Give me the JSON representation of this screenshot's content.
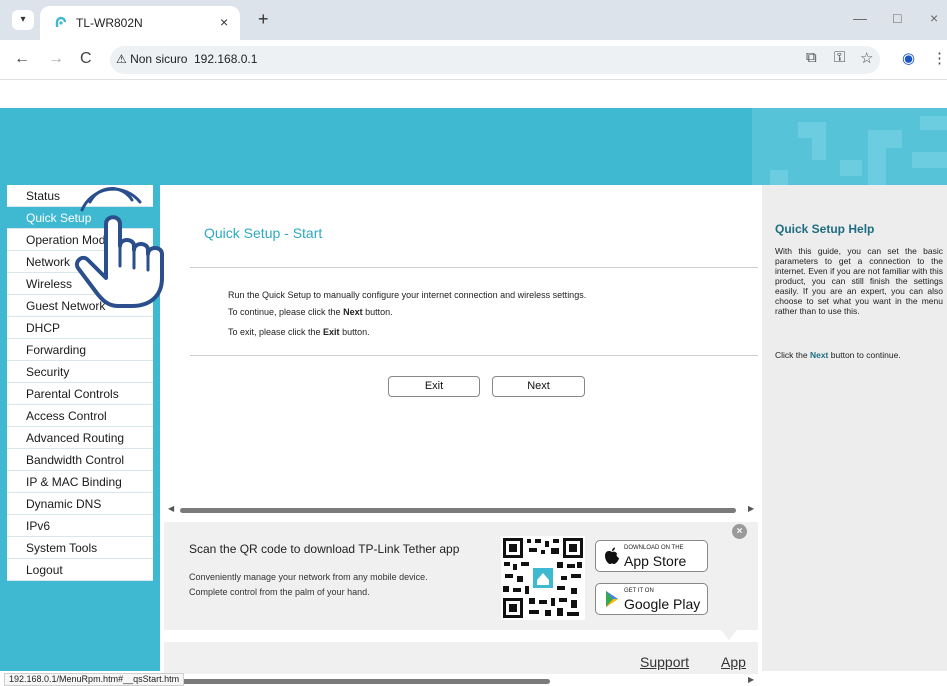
{
  "browser": {
    "tab_title": "TL-WR802N",
    "tab_close": "×",
    "new_tab": "+",
    "back": "←",
    "forward": "→",
    "reload": "C",
    "security_label": "⚠ Non sicuro",
    "url": "192.168.0.1",
    "window_minimize": "—",
    "window_maximize": "□",
    "window_close": "×",
    "status_url": "192.168.0.1/MenuRpm.htm#__qsStart.htm"
  },
  "sidebar": {
    "items": [
      {
        "label": "Status",
        "active": false
      },
      {
        "label": "Quick Setup",
        "active": true
      },
      {
        "label": "Operation Mode",
        "active": false
      },
      {
        "label": "Network",
        "active": false
      },
      {
        "label": "Wireless",
        "active": false
      },
      {
        "label": "Guest Network",
        "active": false
      },
      {
        "label": "DHCP",
        "active": false
      },
      {
        "label": "Forwarding",
        "active": false
      },
      {
        "label": "Security",
        "active": false
      },
      {
        "label": "Parental Controls",
        "active": false
      },
      {
        "label": "Access Control",
        "active": false
      },
      {
        "label": "Advanced Routing",
        "active": false
      },
      {
        "label": "Bandwidth Control",
        "active": false
      },
      {
        "label": "IP & MAC Binding",
        "active": false
      },
      {
        "label": "Dynamic DNS",
        "active": false
      },
      {
        "label": "IPv6",
        "active": false
      },
      {
        "label": "System Tools",
        "active": false
      },
      {
        "label": "Logout",
        "active": false
      }
    ]
  },
  "main": {
    "title": "Quick Setup - Start",
    "line1": "Run the Quick Setup to manually configure your internet connection and wireless settings.",
    "line2_prefix": "To continue, please click the ",
    "line2_bold": "Next",
    "line2_suffix": " button.",
    "line3_prefix": "To exit, please click the ",
    "line3_bold": "Exit",
    "line3_suffix": " button.",
    "exit_label": "Exit",
    "next_label": "Next"
  },
  "promo": {
    "title": "Scan the QR code to download TP-Link Tether app",
    "sub1": "Conveniently manage your network from any mobile device.",
    "sub2": "Complete control from the palm of your hand.",
    "appstore_small": "DOWNLOAD ON THE",
    "appstore_big": "App Store",
    "googleplay_small": "GET IT ON",
    "googleplay_big": "Google Play",
    "close": "×"
  },
  "footer": {
    "support": "Support",
    "app": "App"
  },
  "help": {
    "title": "Quick Setup Help",
    "body": "With this guide, you can set the basic parameters to get a connection to the internet. Even if you are not familiar with this product, you can still finish the settings easily. If you are an expert, you can also choose to set what you want in the menu rather than to use this.",
    "next_prefix": "Click the ",
    "next_bold": "Next",
    "next_suffix": " button to continue."
  },
  "colors": {
    "brand_teal": "#3fb8d1",
    "help_title": "#1f6d82"
  },
  "icons": [
    "dropdown-icon",
    "tplink-favicon",
    "translate-icon",
    "key-icon",
    "star-icon",
    "profile-icon",
    "menu-dots-icon",
    "apple-icon",
    "google-play-icon",
    "qr-code",
    "pointing-hand-icon"
  ]
}
